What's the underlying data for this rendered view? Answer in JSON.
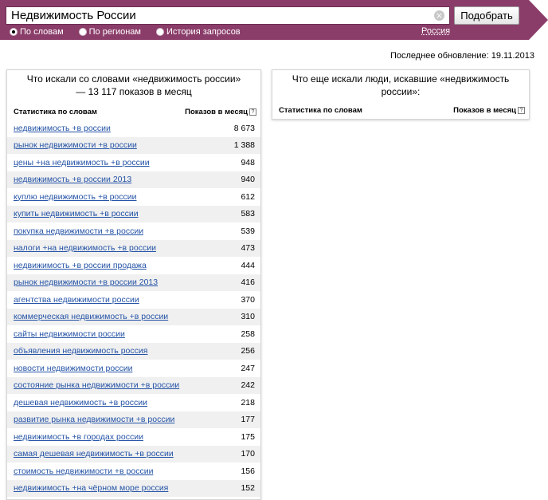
{
  "search": {
    "value": "Недвижимость России",
    "clear_icon": "×",
    "submit_label": "Подобрать"
  },
  "modes": [
    {
      "label": "По словам",
      "checked": true
    },
    {
      "label": "По регионам",
      "checked": false
    },
    {
      "label": "История запросов",
      "checked": false
    }
  ],
  "region": "Россия",
  "last_update": "Последнее обновление: 19.11.2013",
  "left_panel": {
    "title": "Что искали со словами «недвижимость россии» — 13 117 показов в месяц",
    "col_words": "Статистика по словам",
    "col_shows": "Показов в месяц",
    "help": "?",
    "rows": [
      {
        "query": "недвижимость +в россии",
        "count": "8 673"
      },
      {
        "query": "рынок недвижимости +в россии",
        "count": "1 388"
      },
      {
        "query": "цены +на недвижимость +в россии",
        "count": "948"
      },
      {
        "query": "недвижимость +в россии 2013",
        "count": "940"
      },
      {
        "query": "куплю недвижимость +в россии",
        "count": "612"
      },
      {
        "query": "купить недвижимость +в россии",
        "count": "583"
      },
      {
        "query": "покупка недвижимости +в россии",
        "count": "539"
      },
      {
        "query": "налоги +на недвижимость +в россии",
        "count": "473"
      },
      {
        "query": "недвижимость +в россии продажа",
        "count": "444"
      },
      {
        "query": "рынок недвижимости +в россии 2013",
        "count": "416"
      },
      {
        "query": "агентства недвижимости россии",
        "count": "370"
      },
      {
        "query": "коммерческая недвижимость +в россии",
        "count": "310"
      },
      {
        "query": "сайты недвижимости россии",
        "count": "258"
      },
      {
        "query": "объявления недвижимость россия",
        "count": "256"
      },
      {
        "query": "новости недвижимости россии",
        "count": "247"
      },
      {
        "query": "состояние рынка недвижимости +в россии",
        "count": "242"
      },
      {
        "query": "дешевая недвижимость +в россии",
        "count": "218"
      },
      {
        "query": "развитие рынка недвижимости +в россии",
        "count": "177"
      },
      {
        "query": "недвижимость +в городах россии",
        "count": "175"
      },
      {
        "query": "самая дешевая недвижимость +в россии",
        "count": "170"
      },
      {
        "query": "стоимость недвижимости +в россии",
        "count": "156"
      },
      {
        "query": "недвижимость +на чёрном море россия",
        "count": "152"
      }
    ]
  },
  "right_panel": {
    "title": "Что еще искали люди, искавшие «недвижимость россии»:",
    "col_words": "Статистика по словам",
    "col_shows": "Показов в месяц",
    "help": "?"
  },
  "colors": {
    "header": "#8b3d6a",
    "link": "#2453a6",
    "row_stripe": "#f0f0f0"
  }
}
